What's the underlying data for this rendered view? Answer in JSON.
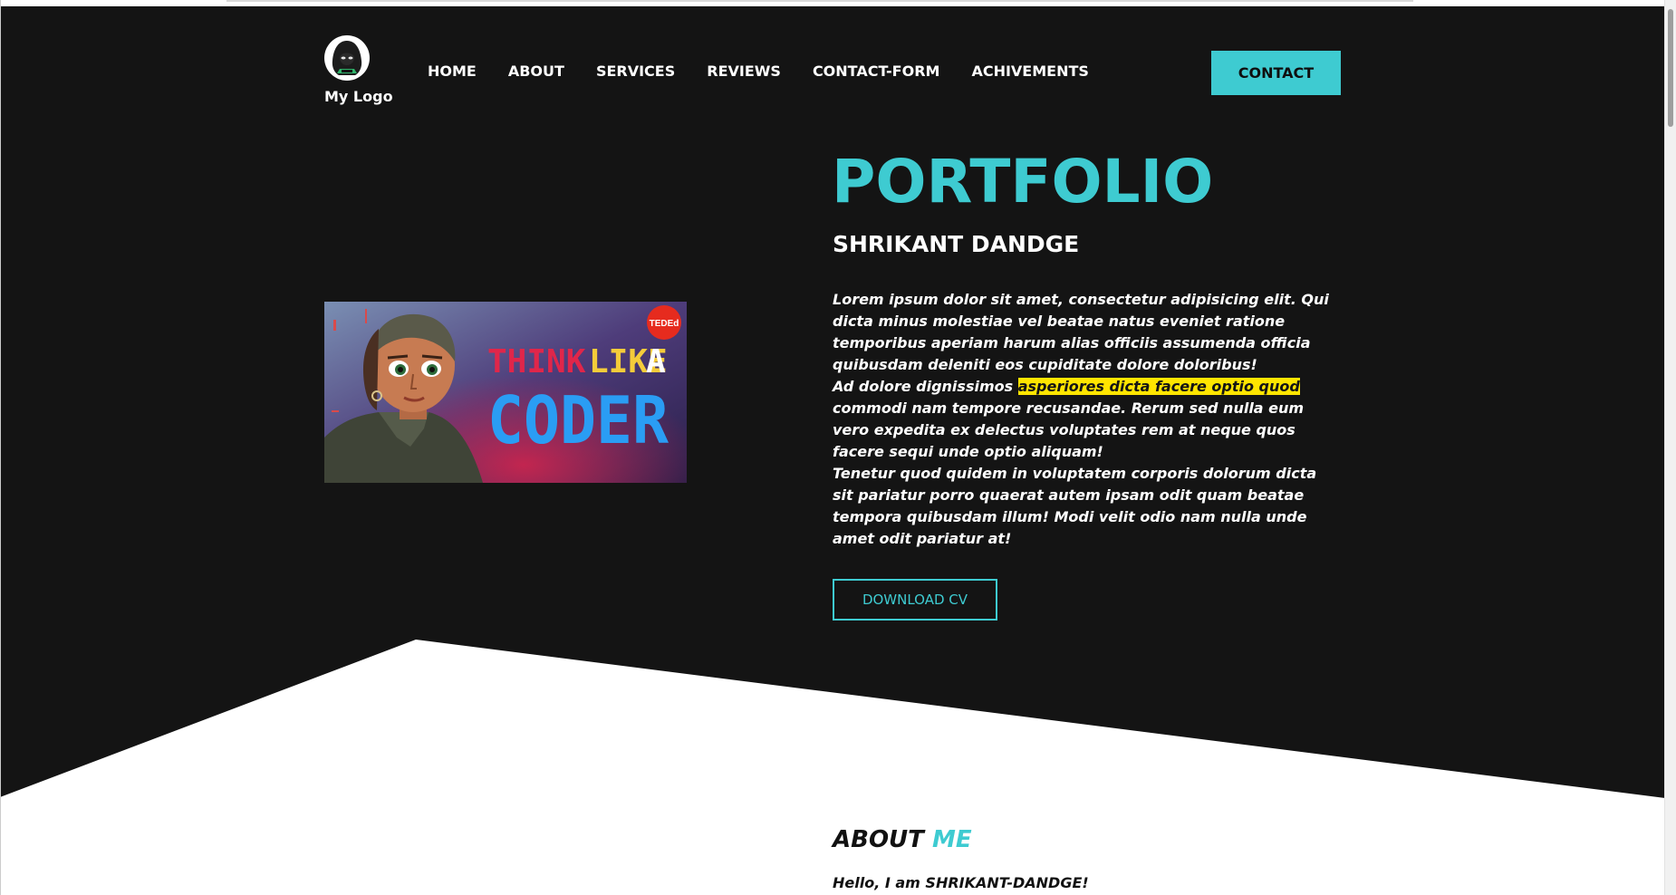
{
  "brand": {
    "logo_text": "My Logo",
    "logo_icon": "hacker-avatar-icon"
  },
  "nav": {
    "items": [
      {
        "label": "HOME"
      },
      {
        "label": "ABOUT"
      },
      {
        "label": "SERVICES"
      },
      {
        "label": "REVIEWS"
      },
      {
        "label": "CONTACT-FORM"
      },
      {
        "label": "ACHIVEMENTS"
      }
    ],
    "contact_label": "CONTACT"
  },
  "hero": {
    "title": "PORTFOLIO",
    "name": "SHRIKANT DANDGE",
    "paragraph1": "Lorem ipsum dolor sit amet, consectetur adipisicing elit. Qui dicta minus molestiae vel beatae natus eveniet ratione temporibus aperiam harum alias officiis assumenda officia quibusdam deleniti eos cupiditate dolore doloribus!",
    "paragraph2_pre": "Ad dolore dignissimos ",
    "paragraph2_highlight": "asperiores dicta facere optio quod",
    "paragraph2_post": " commodi nam tempore recusandae. Rerum sed nulla eum vero expedita ex delectus voluptates rem at neque quos facere sequi unde optio aliquam!",
    "paragraph3": "Tenetur quod quidem in voluptatem corporis dolorum dicta sit pariatur porro quaerat autem ipsam odit quam beatae tempora quibusdam illum! Modi velit odio nam nulla unde amet odit pariatur at!",
    "download_label": "DOWNLOAD CV",
    "thumbnail": {
      "badge": "TEDEd",
      "line1_word1": "THINK",
      "line1_word2": "LIKE",
      "line1_word3": "A",
      "line2": "CODER"
    }
  },
  "about": {
    "heading_main": "ABOUT",
    "heading_accent": "ME",
    "hello": "Hello, I am SHRIKANT-DANDGE!"
  },
  "colors": {
    "accent": "#3ecbd1",
    "hero_bg": "#141414",
    "highlight": "#ffe500"
  }
}
